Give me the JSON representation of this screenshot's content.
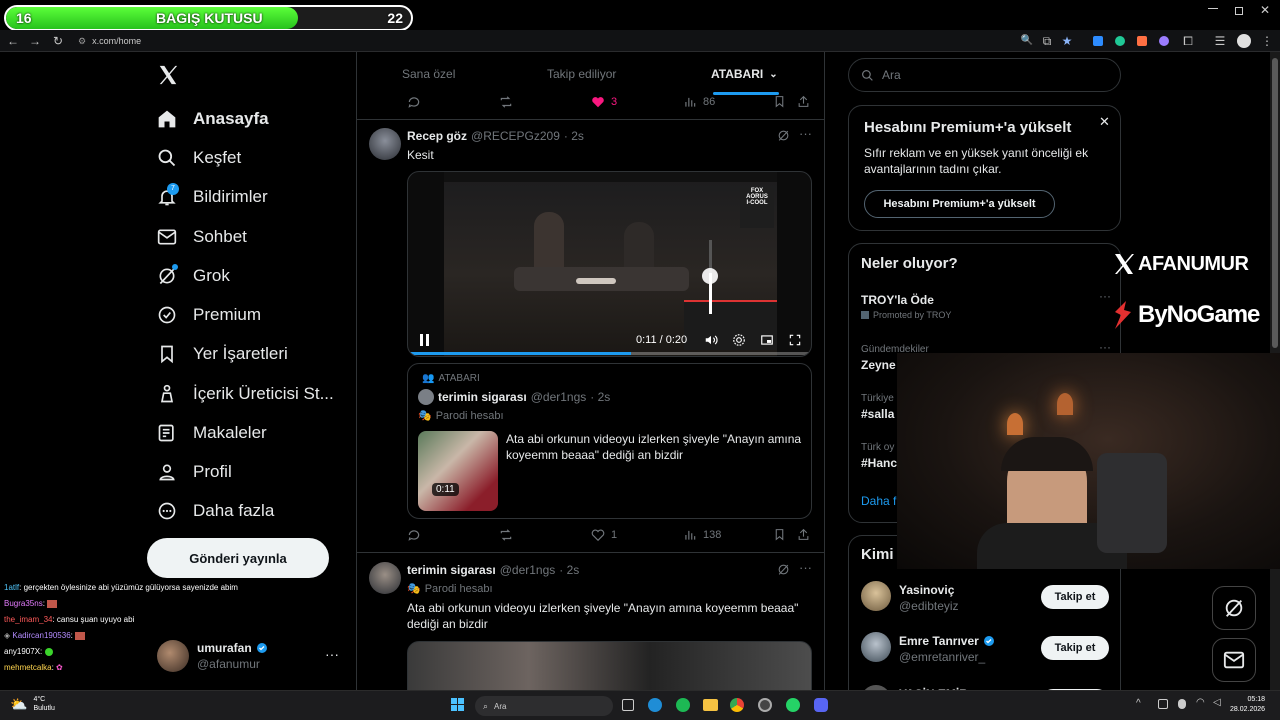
{
  "donation": {
    "left_num": "16",
    "title": "BAGIŞ KUTUSU",
    "right_num": "22",
    "progress": 0.72
  },
  "browser": {
    "url": "x.com/home"
  },
  "nav": {
    "items": [
      {
        "label": "Anasayfa"
      },
      {
        "label": "Keşfet"
      },
      {
        "label": "Bildirimler",
        "badge": "7"
      },
      {
        "label": "Sohbet"
      },
      {
        "label": "Grok"
      },
      {
        "label": "Premium"
      },
      {
        "label": "Yer İşaretleri"
      },
      {
        "label": "İçerik Üreticisi St..."
      },
      {
        "label": "Makaleler"
      },
      {
        "label": "Profil"
      },
      {
        "label": "Daha fazla"
      }
    ],
    "post_button": "Gönderi yayınla",
    "account": {
      "name": "umurafan",
      "handle": "@afanumur"
    }
  },
  "feed": {
    "tabs": [
      "Sana özel",
      "Takip ediliyor",
      "ATABARI"
    ],
    "top_actions": {
      "likes": "3",
      "views": "86"
    },
    "tweet1": {
      "name": "Recep göz",
      "handle": "@RECEPGz209",
      "time": "· 2s",
      "text": "Kesit",
      "video": {
        "time": "0:11 / 0:20",
        "progress": 0.55
      },
      "quote": {
        "community": "ATABARI",
        "name": "terimin sigarası",
        "handle": "@der1ngs",
        "time": "· 2s",
        "badge": "Parodi hesabı",
        "text": "Ata abi orkunun videoyu izlerken şiveyle \"Anayın amına koyeemm beaaa\" dediği an bizdir",
        "duration": "0:11"
      },
      "actions": {
        "likes": "1",
        "views": "138"
      }
    },
    "tweet2": {
      "name": "terimin sigarası",
      "handle": "@der1ngs",
      "time": "· 2s",
      "badge": "Parodi hesabı",
      "text": "Ata abi orkunun videoyu izlerken şiveyle \"Anayın amına koyeemm beaaa\" dediği an bizdir"
    }
  },
  "right": {
    "search_placeholder": "Ara",
    "premium": {
      "title": "Hesabını Premium+'a yükselt",
      "body": "Sıfır reklam ve en yüksek yanıt önceliği ek avantajlarının tadını çıkar.",
      "button": "Hesabını Premium+'a yükselt"
    },
    "trends": {
      "title": "Neler oluyor?",
      "items": [
        {
          "context": "",
          "name": "TROY'la Öde",
          "sub": "Promoted by TROY"
        },
        {
          "context": "Gündemdekiler",
          "name": "Zeyne",
          "sub": ""
        },
        {
          "context": "Türkiye",
          "name": "#salla",
          "sub": ""
        },
        {
          "context": "Türk oy",
          "name": "#Hanc",
          "sub": ""
        }
      ],
      "more": "Daha f"
    },
    "follow": {
      "title": "Kimi",
      "users": [
        {
          "name": "Yasinoviç",
          "handle": "@edibteyiz",
          "button": "Takip et"
        },
        {
          "name": "Emre Tanrıver",
          "handle": "@emretanriver_",
          "button": "Takip et"
        },
        {
          "name": "YASİN EMİR",
          "handle": "",
          "button": ""
        }
      ]
    }
  },
  "overlay": {
    "brand1": "AFANUMUR",
    "brand2": "ByNoGame"
  },
  "chat": [
    {
      "user": "1atlf",
      "color": "#4fc3f7",
      "msg": ": gerçekten öylesinize abi yüzümüz gülüyorsa sayenizde abim"
    },
    {
      "user": "Bugra35ns",
      "color": "#e57dff",
      "msg": ":"
    },
    {
      "user": "the_imam_34",
      "color": "#ff5a5a",
      "msg": ": cansu şuan uyuyo abi"
    },
    {
      "user": "Kadircan190536",
      "color": "#b48cff",
      "msg": ":"
    },
    {
      "user": "any1907X",
      "color": "#ffffff",
      "msg": ":"
    },
    {
      "user": "mehmetcalka",
      "color": "#ffd54f",
      "msg": ":"
    }
  ],
  "taskbar": {
    "weather_temp": "4°C",
    "weather_desc": "Bulutlu",
    "search": "Ara",
    "time": "05:18",
    "date": "28.02.2026"
  },
  "colors": {
    "accent": "#1d9bf0",
    "like": "#f91880",
    "green": "#3bd42b"
  }
}
